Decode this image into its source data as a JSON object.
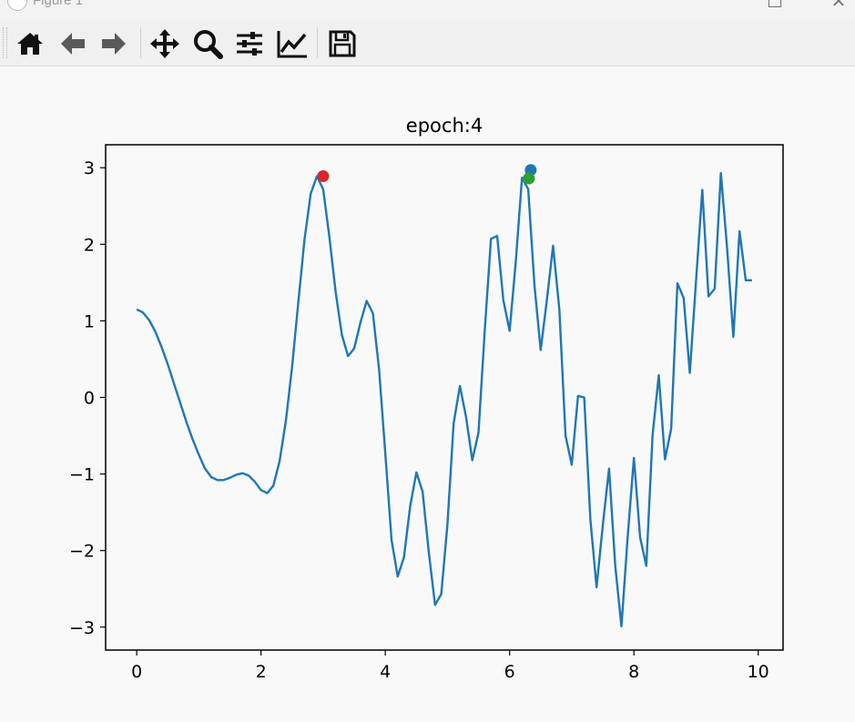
{
  "window": {
    "title": "Figure 1"
  },
  "toolbar": {
    "buttons": [
      {
        "icon": "home-icon"
      },
      {
        "icon": "back-arrow-icon"
      },
      {
        "icon": "forward-arrow-icon"
      },
      {
        "icon": "pan-icon"
      },
      {
        "icon": "zoom-icon"
      },
      {
        "icon": "configure-subplots-icon"
      },
      {
        "icon": "edit-axis-icon"
      },
      {
        "icon": "save-icon"
      }
    ]
  },
  "chart_data": {
    "type": "line",
    "title": "epoch:4",
    "xlabel": "",
    "ylabel": "",
    "xlim": [
      -0.5,
      10.4
    ],
    "ylim": [
      -3.3,
      3.3
    ],
    "xticks": [
      0,
      2,
      4,
      6,
      8,
      10
    ],
    "yticks": [
      -3,
      -2,
      -1,
      0,
      1,
      2,
      3
    ],
    "grid": false,
    "colors": {
      "line": "#1f77b4",
      "red": "#d62728",
      "blue": "#1f77b4",
      "green": "#2ca02c"
    },
    "series": [
      {
        "x": [
          0,
          0.1,
          0.2,
          0.3,
          0.4,
          0.5,
          0.6,
          0.7,
          0.8,
          0.9,
          1.0,
          1.1,
          1.2,
          1.3,
          1.4,
          1.5,
          1.6,
          1.7,
          1.8,
          1.9,
          2.0,
          2.1,
          2.2,
          2.3,
          2.4,
          2.5,
          2.6,
          2.7,
          2.8,
          2.9,
          3.0,
          3.1,
          3.2,
          3.3,
          3.4,
          3.5,
          3.6,
          3.7,
          3.8,
          3.9,
          4.0,
          4.1,
          4.2,
          4.3,
          4.4,
          4.5,
          4.6,
          4.7,
          4.8,
          4.9,
          5.0,
          5.1,
          5.2,
          5.3,
          5.4,
          5.5,
          5.6,
          5.7,
          5.8,
          5.9,
          6.0,
          6.1,
          6.2,
          6.3,
          6.4,
          6.5,
          6.6,
          6.7,
          6.8,
          6.9,
          7.0,
          7.1,
          7.2,
          7.3,
          7.4,
          7.5,
          7.6,
          7.7,
          7.8,
          7.9,
          8.0,
          8.1,
          8.2,
          8.3,
          8.4,
          8.5,
          8.6,
          8.7,
          8.8,
          8.9,
          9.0,
          9.1,
          9.2,
          9.3,
          9.4,
          9.5,
          9.6,
          9.7,
          9.8,
          9.9
        ],
        "y": [
          1.15,
          1.11,
          1.01,
          0.86,
          0.66,
          0.43,
          0.18,
          -0.07,
          -0.32,
          -0.55,
          -0.75,
          -0.93,
          -1.04,
          -1.08,
          -1.08,
          -1.05,
          -1.01,
          -0.99,
          -1.02,
          -1.1,
          -1.21,
          -1.25,
          -1.15,
          -0.83,
          -0.31,
          0.4,
          1.24,
          2.06,
          2.66,
          2.89,
          2.72,
          2.1,
          1.38,
          0.82,
          0.54,
          0.64,
          0.98,
          1.26,
          1.1,
          0.37,
          -0.74,
          -1.86,
          -2.34,
          -2.09,
          -1.42,
          -0.98,
          -1.23,
          -2.02,
          -2.71,
          -2.57,
          -1.66,
          -0.34,
          0.15,
          -0.26,
          -0.82,
          -0.46,
          0.88,
          2.07,
          2.11,
          1.27,
          0.87,
          1.78,
          2.87,
          2.72,
          1.46,
          0.62,
          1.27,
          1.98,
          1.15,
          -0.5,
          -0.88,
          0.02,
          0.0,
          -1.6,
          -2.48,
          -1.66,
          -0.93,
          -2.2,
          -2.99,
          -1.81,
          -0.79,
          -1.83,
          -2.2,
          -0.49,
          0.29,
          -0.81,
          -0.41,
          1.49,
          1.3,
          0.32,
          1.52,
          2.71,
          1.32,
          1.42,
          2.93,
          1.94,
          0.79,
          2.17,
          1.53,
          1.53
        ]
      }
    ],
    "points": [
      {
        "x": 3.0,
        "y": 2.89,
        "color": "red"
      },
      {
        "x": 6.34,
        "y": 2.97,
        "color": "blue"
      },
      {
        "x": 6.31,
        "y": 2.86,
        "color": "green"
      }
    ]
  }
}
